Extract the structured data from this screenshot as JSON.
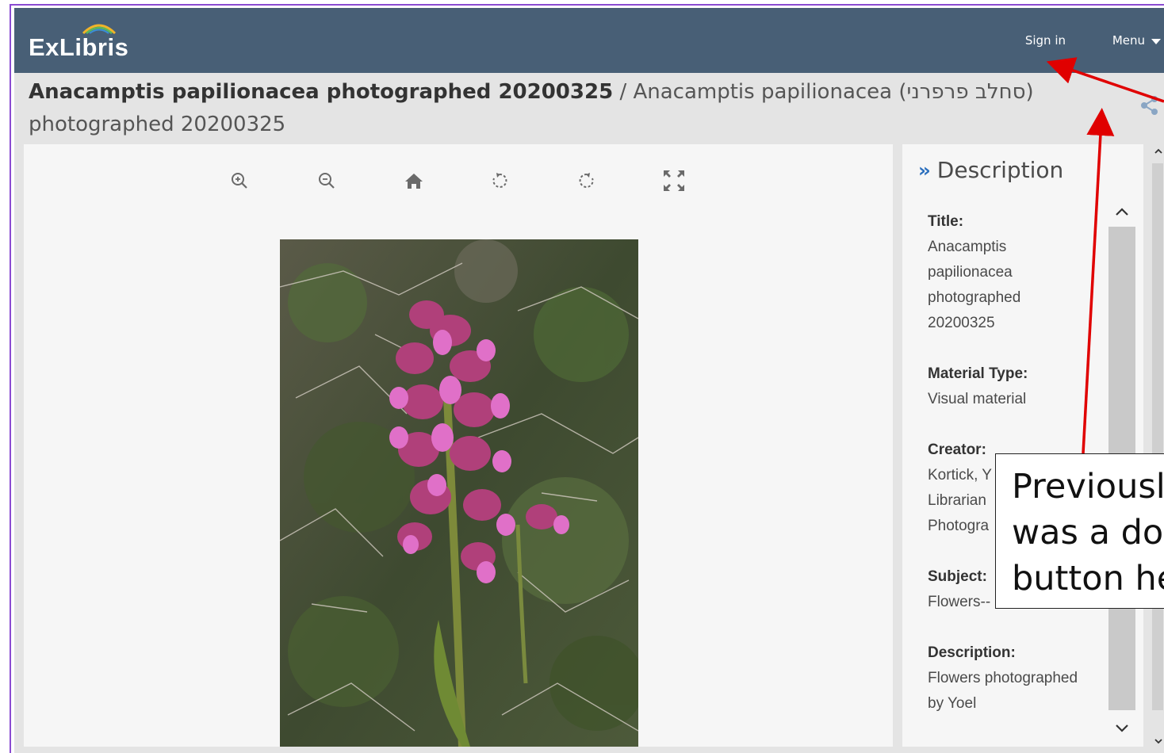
{
  "header": {
    "logo_text": "ExLibris",
    "sign_in": "Sign in",
    "menu": "Menu"
  },
  "record": {
    "title_bold": "Anacamptis papilionacea photographed 20200325",
    "title_rest": "/ Anacamptis papilionacea (סחלב פרפרני)",
    "title_line2": "photographed 20200325"
  },
  "viewer": {
    "toolbar": [
      "zoom-in-icon",
      "zoom-out-icon",
      "home-icon",
      "rotate-left-icon",
      "rotate-right-icon",
      "fullscreen-icon"
    ]
  },
  "description": {
    "heading": "Description",
    "fields": [
      {
        "label": "Title:",
        "lines": [
          "Anacamptis",
          "papilionacea",
          "photographed",
          "20200325"
        ]
      },
      {
        "label": "Material Type:",
        "lines": [
          "Visual material"
        ]
      },
      {
        "label": "Creator:",
        "lines": [
          "Kortick, Y",
          "Librarian",
          "Photogra"
        ]
      },
      {
        "label": "Subject:",
        "lines": [
          "Flowers--"
        ]
      },
      {
        "label": "Description:",
        "lines": [
          "Flowers photographed",
          "by Yoel"
        ]
      }
    ]
  },
  "annotation": {
    "lines": [
      "Previousl",
      "was a do",
      "button he"
    ],
    "color": "#e00000"
  }
}
